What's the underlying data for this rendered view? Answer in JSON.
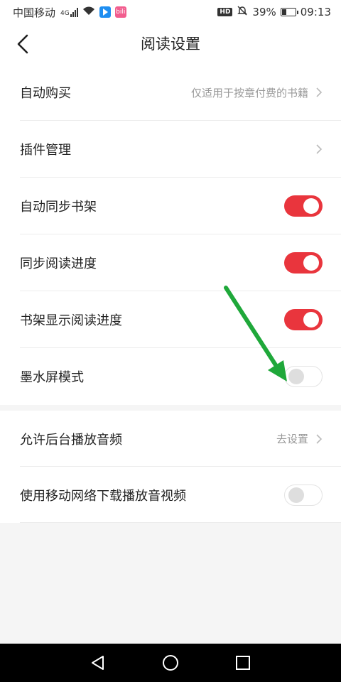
{
  "status_bar": {
    "carrier": "中国移动",
    "network": "4G",
    "battery_text": "39%",
    "battery_level": 0.39,
    "hd": "HD",
    "time": "09:13",
    "app_badge_text": "bili",
    "icons": [
      "signal-icon",
      "wifi-icon",
      "app-icon-blue",
      "app-icon-pink",
      "hd-icon",
      "mute-bell-icon",
      "battery-icon"
    ]
  },
  "header": {
    "title": "阅读设置",
    "back_icon": "chevron-left-icon"
  },
  "settings": {
    "auto_buy": {
      "label": "自动购买",
      "hint": "仅适用于按章付费的书籍"
    },
    "plugin_manage": {
      "label": "插件管理"
    },
    "auto_sync_shelf": {
      "label": "自动同步书架",
      "enabled": true
    },
    "sync_progress": {
      "label": "同步阅读进度",
      "enabled": true
    },
    "shelf_show_progress": {
      "label": "书架显示阅读进度",
      "enabled": true
    },
    "eink_mode": {
      "label": "墨水屏模式",
      "enabled": false
    },
    "background_audio": {
      "label": "允许后台播放音频",
      "hint": "去设置"
    },
    "mobile_download": {
      "label": "使用移动网络下载播放音视频",
      "enabled": false
    }
  },
  "colors": {
    "toggle_on": "#e9353d",
    "annotation_arrow": "#1fa83a"
  },
  "system_nav": {
    "icons": [
      "back-triangle-icon",
      "home-circle-icon",
      "recents-square-icon"
    ]
  }
}
